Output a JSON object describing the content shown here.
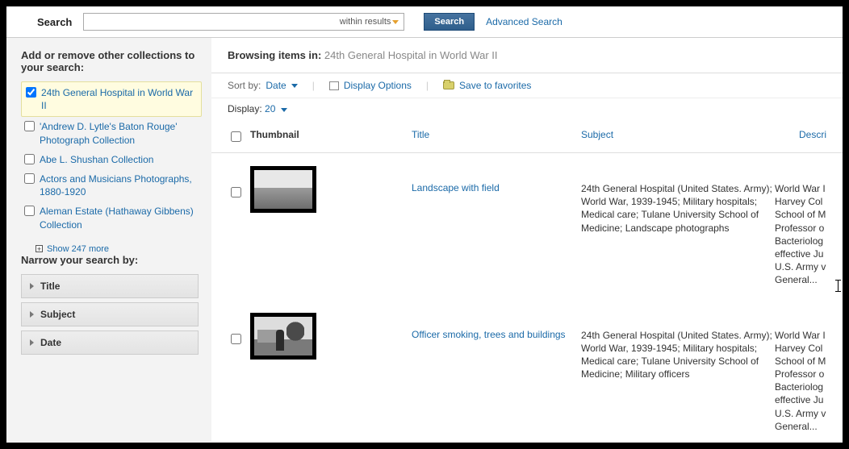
{
  "search": {
    "label": "Search",
    "value": "",
    "within_results": "within results",
    "button": "Search",
    "advanced": "Advanced Search"
  },
  "sidebar": {
    "add_remove_heading": "Add or remove other collections to your search:",
    "collections": [
      {
        "label": "24th General Hospital in World War II",
        "checked": true
      },
      {
        "label": "'Andrew D. Lytle's Baton Rouge' Photograph Collection",
        "checked": false
      },
      {
        "label": "Abe L. Shushan Collection",
        "checked": false
      },
      {
        "label": "Actors and Musicians Photographs, 1880-1920",
        "checked": false
      },
      {
        "label": "Aleman Estate (Hathaway Gibbens) Collection",
        "checked": false
      }
    ],
    "show_more": "Show 247 more",
    "narrow_heading": "Narrow your search by:",
    "facets": [
      {
        "label": "Title"
      },
      {
        "label": "Subject"
      },
      {
        "label": "Date"
      }
    ]
  },
  "main": {
    "browsing_label": "Browsing items in:",
    "browsing_value": "24th General Hospital in World War II",
    "sort_by_label": "Sort by:",
    "sort_by_value": "Date",
    "display_options": "Display Options",
    "save_favorites": "Save to favorites",
    "display_label": "Display:",
    "display_count": "20",
    "headers": {
      "thumbnail": "Thumbnail",
      "title": "Title",
      "subject": "Subject",
      "description": "Descri"
    },
    "rows": [
      {
        "title": "Landscape with field",
        "subject": "24th General Hospital (United States. Army); World War, 1939-1945; Military hospitals; Medical care; Tulane University School of Medicine; Landscape photographs",
        "description": "World War I\nHarvey Col\nSchool of M\nProfessor o\nBacteriolog\neffective Ju\nU.S. Army v\nGeneral..."
      },
      {
        "title": "Officer smoking, trees and buildings",
        "subject": "24th General Hospital (United States. Army); World War, 1939-1945; Military hospitals; Medical care; Tulane University School of Medicine; Military officers",
        "description": "World War I\nHarvey Col\nSchool of M\nProfessor o\nBacteriolog\neffective Ju\nU.S. Army v\nGeneral..."
      }
    ]
  }
}
